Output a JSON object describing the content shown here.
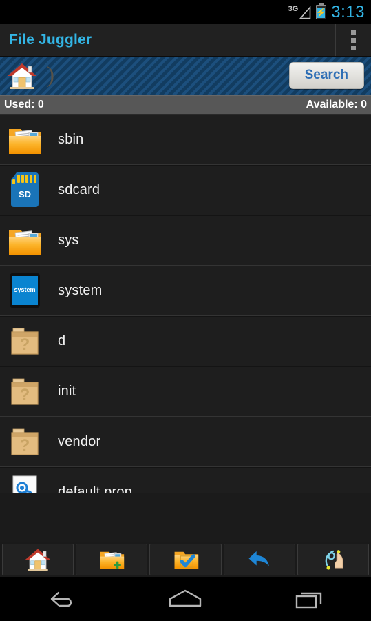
{
  "status_bar": {
    "network_label": "3G",
    "signal_icon": "signal-triangle-icon",
    "battery_icon": "battery-charging-icon",
    "time": "3:13"
  },
  "action_bar": {
    "app_title": "File Juggler",
    "overflow_icon": "overflow-menu-icon"
  },
  "breadcrumb": {
    "home_icon": "home-icon",
    "separator": ")",
    "search_label": "Search"
  },
  "usage_bar": {
    "used_label": "Used: 0",
    "available_label": "Available: 0"
  },
  "file_list": {
    "items": [
      {
        "name": "sbin",
        "icon": "folder-documents-icon"
      },
      {
        "name": "sdcard",
        "icon": "sdcard-icon",
        "badge": "SD"
      },
      {
        "name": "sys",
        "icon": "folder-documents-icon"
      },
      {
        "name": "system",
        "icon": "system-icon",
        "badge": "system"
      },
      {
        "name": "d",
        "icon": "unknown-box-icon"
      },
      {
        "name": "init",
        "icon": "unknown-box-icon"
      },
      {
        "name": "vendor",
        "icon": "unknown-box-icon"
      },
      {
        "name": "default.prop",
        "icon": "properties-file-icon"
      }
    ]
  },
  "toolbar": {
    "buttons": [
      {
        "name": "home",
        "icon": "home-icon"
      },
      {
        "name": "new-folder",
        "icon": "new-folder-icon"
      },
      {
        "name": "select",
        "icon": "folder-check-icon"
      },
      {
        "name": "back",
        "icon": "back-arrow-icon"
      },
      {
        "name": "gesture",
        "icon": "gesture-hand-icon"
      }
    ]
  },
  "nav_bar": {
    "back_icon": "android-back-icon",
    "home_icon": "android-home-icon",
    "recents_icon": "android-recents-icon"
  },
  "colors": {
    "accent_blue": "#33b5e5",
    "stripe_blue": "#1c4f7d",
    "stripe_dark": "#123c60",
    "list_bg": "#1e1e1e",
    "usage_bar": "#575757",
    "search_text": "#2f6fb5"
  }
}
